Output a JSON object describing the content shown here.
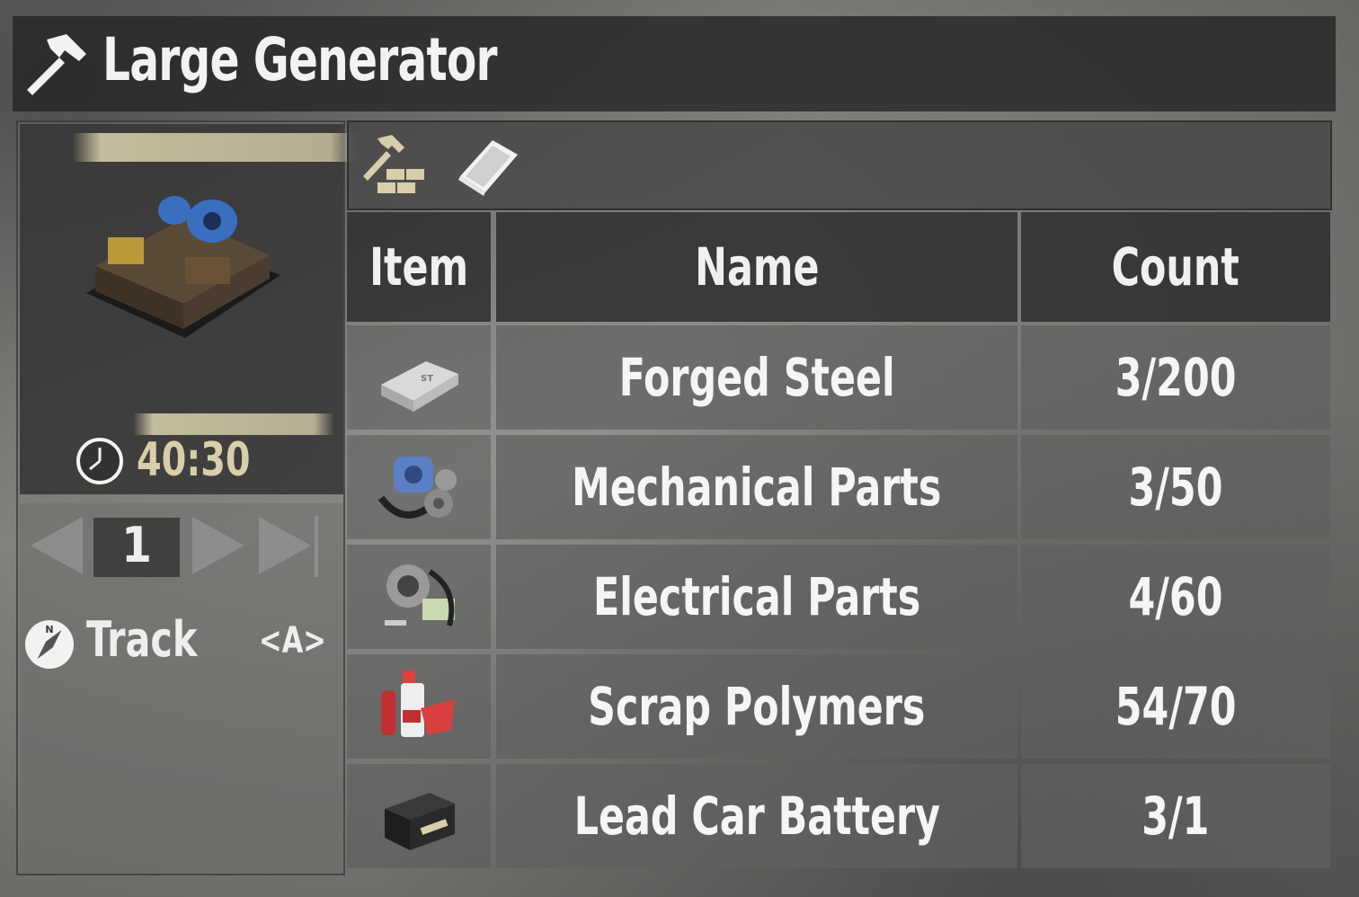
{
  "window": {
    "title": "Large Generator",
    "title_icon": "hammer-icon"
  },
  "preview": {
    "item_icon": "large-generator",
    "craft_time": "40:30",
    "time_icon": "clock-icon"
  },
  "controls": {
    "quantity": "1",
    "track_label": "Track",
    "track_key": "<A>"
  },
  "tabs": [
    {
      "name": "craft-requirements",
      "icon": "hammer-bricks-icon",
      "active": true
    },
    {
      "name": "recipe-book",
      "icon": "book-icon",
      "active": false
    }
  ],
  "table": {
    "headers": {
      "item": "Item",
      "name": "Name",
      "count": "Count"
    },
    "rows": [
      {
        "icon": "forged-steel-icon",
        "name": "Forged Steel",
        "count": "3/200"
      },
      {
        "icon": "mechanical-parts-icon",
        "name": "Mechanical Parts",
        "count": "3/50"
      },
      {
        "icon": "electrical-parts-icon",
        "name": "Electrical Parts",
        "count": "4/60"
      },
      {
        "icon": "scrap-polymers-icon",
        "name": "Scrap Polymers",
        "count": "54/70"
      },
      {
        "icon": "lead-car-battery-icon",
        "name": "Lead Car Battery",
        "count": "3/1"
      }
    ]
  },
  "colors": {
    "accent_tan": "#d8ceaa",
    "panel_dark": "#2d2d2d",
    "text": "#f5f5f5"
  }
}
